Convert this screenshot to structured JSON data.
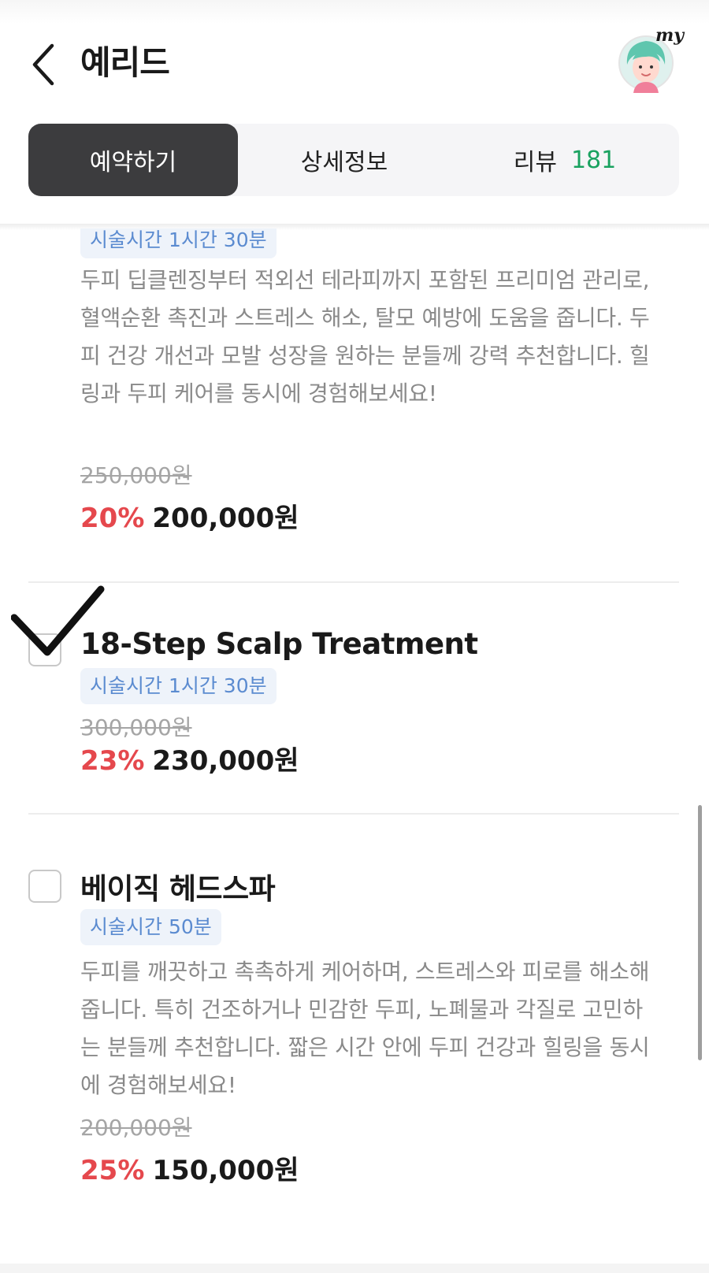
{
  "header": {
    "title": "예리드",
    "avatar_text": "my"
  },
  "tabs": [
    {
      "label": "예약하기",
      "active": true
    },
    {
      "label": "상세정보",
      "active": false
    },
    {
      "label": "리뷰",
      "count": "181",
      "active": false
    }
  ],
  "items": [
    {
      "duration": "시술시간 1시간 30분",
      "description": "두피 딥클렌징부터 적외선 테라피까지 포함된 프리미엄 관리로, 혈액순환 촉진과 스트레스 해소, 탈모 예방에 도움을 줍니다. 두피 건강 개선과 모발 성장을 원하는 분들께 강력 추천합니다. 힐링과 두피 케어를 동시에 경험해보세요!",
      "original_price": "250,000원",
      "discount": "20%",
      "price": "200,000원"
    },
    {
      "name": "18-Step Scalp Treatment",
      "duration": "시술시간 1시간 30분",
      "original_price": "300,000원",
      "discount": "23%",
      "price": "230,000원",
      "checked_mark": true
    },
    {
      "name": "베이직 헤드스파",
      "duration": "시술시간 50분",
      "description": "두피를 깨끗하고 촉촉하게 케어하며, 스트레스와 피로를 해소해줍니다. 특히 건조하거나 민감한 두피, 노폐물과 각질로 고민하는 분들께 추천합니다. 짧은 시간 안에 두피 건강과 힐링을 동시에 경험해보세요!",
      "original_price": "200,000원",
      "discount": "25%",
      "price": "150,000원"
    }
  ],
  "colors": {
    "active_tab_bg": "#3c3c3e",
    "review_count": "#1aa260",
    "discount": "#e5484d",
    "badge_text": "#5b8bd0",
    "badge_bg": "#eef3fa"
  },
  "icons": [
    "back-arrow-icon",
    "avatar-icon",
    "checkmark-icon"
  ]
}
